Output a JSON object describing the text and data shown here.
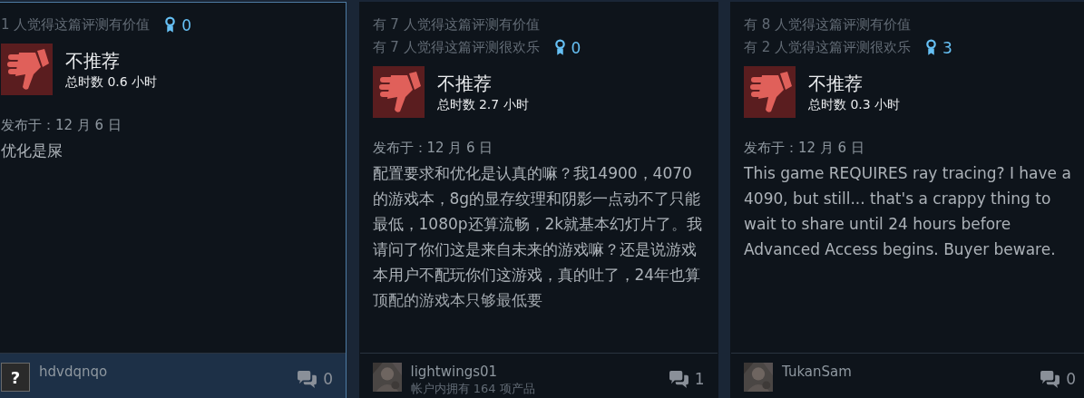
{
  "reviews": [
    {
      "hovered": true,
      "votes": [
        "1 人觉得这篇评测有价值"
      ],
      "awards": "0",
      "recommended": false,
      "verdict": "不推荐",
      "hours": "总时数 0.6 小时",
      "posted": "发布于：12 月 6 日",
      "body": "优化是屎",
      "author": "hdvdqnqo",
      "avatar": {
        "kind": "unknown",
        "glyph": "?"
      },
      "comments": "0"
    },
    {
      "hovered": false,
      "votes": [
        "有 7 人觉得这篇评测有价值",
        "有 7 人觉得这篇评测很欢乐"
      ],
      "awards": "0",
      "recommended": false,
      "verdict": "不推荐",
      "hours": "总时数 2.7 小时",
      "posted": "发布于：12 月 6 日",
      "body": "配置要求和优化是认真的嘛？我14900，4070的游戏本，8g的显存纹理和阴影一点动不了只能最低，1080p还算流畅，2k就基本幻灯片了。我请问了你们这是来自未来的游戏嘛？还是说游戏本用户不配玩你们这游戏，真的吐了，24年也算顶配的游戏本只够最低要",
      "author": "lightwings01",
      "avatar": {
        "kind": "picture"
      },
      "products": "帐户内拥有 164 项产品",
      "comments": "1"
    },
    {
      "hovered": false,
      "votes": [
        "有 8 人觉得这篇评测有价值",
        "有 2 人觉得这篇评测很欢乐"
      ],
      "awards": "3",
      "recommended": false,
      "verdict": "不推荐",
      "hours": "总时数 0.3 小时",
      "posted": "发布于：12 月 6 日",
      "body": "This game REQUIRES ray tracing? I have a 4090, but still... that's a crappy thing to wait to share until 24 hours before Advanced Access begins. Buyer beware.",
      "author": "TukanSam",
      "avatar": {
        "kind": "picture"
      },
      "comments": "0"
    }
  ]
}
